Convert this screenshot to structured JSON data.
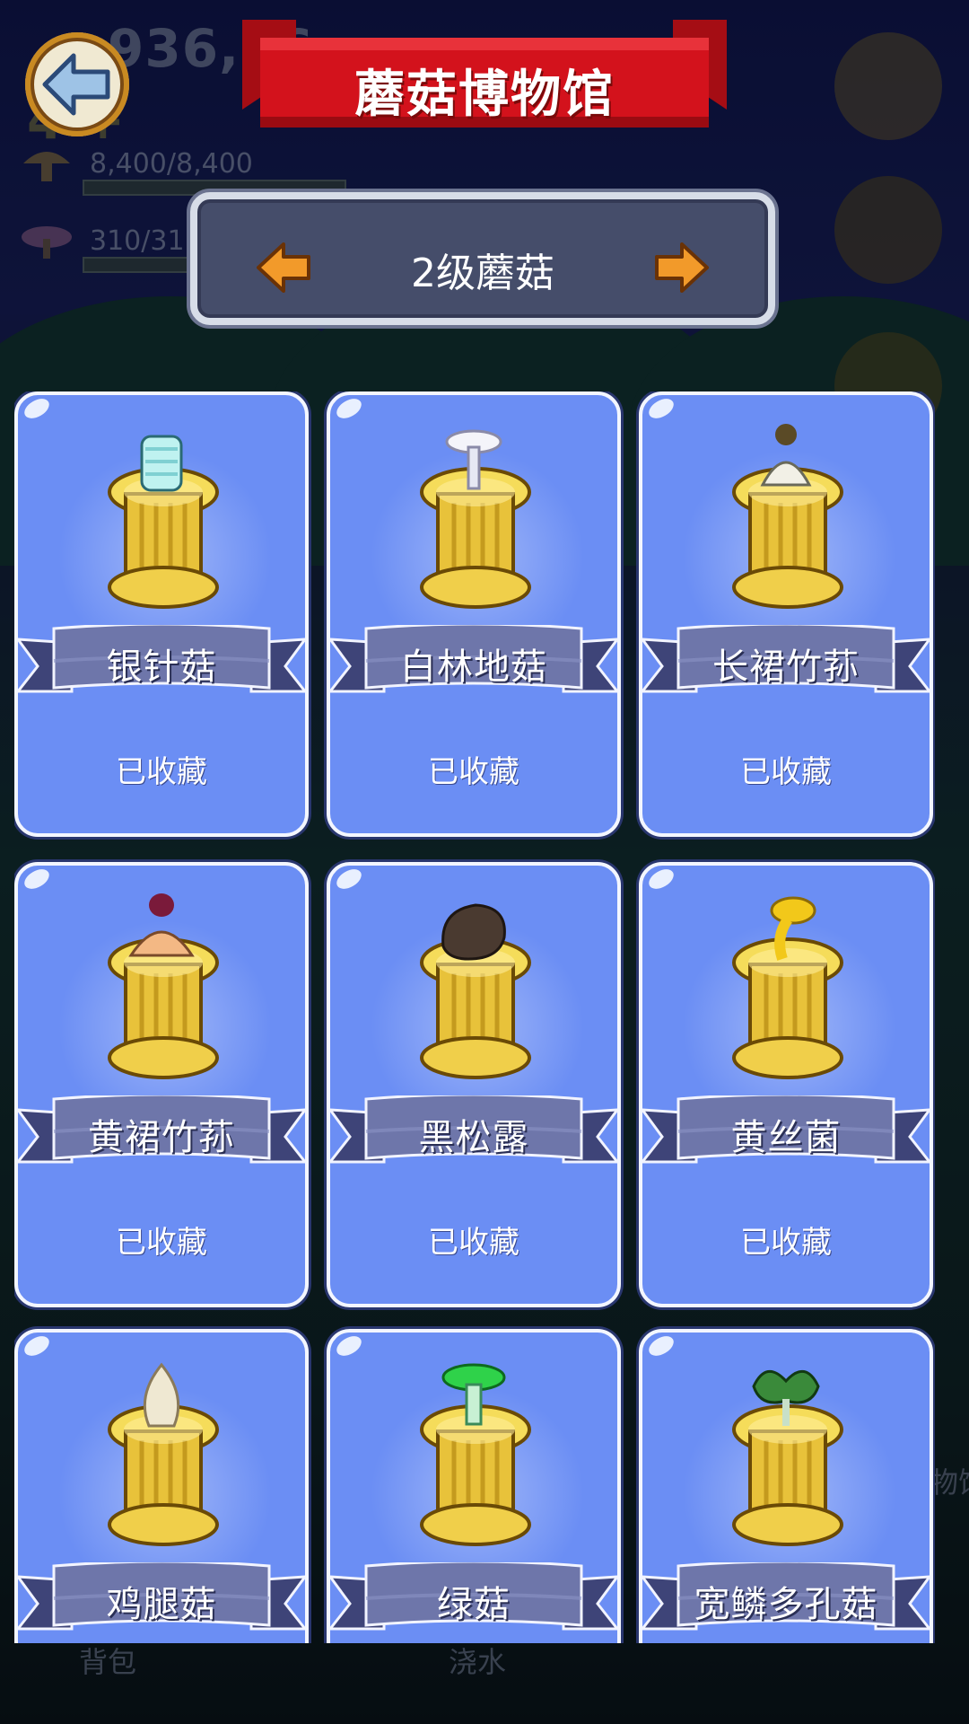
{
  "header": {
    "title": "蘑菇博物馆"
  },
  "background": {
    "coins": "936,56",
    "coin_sub": "4 +",
    "stat1": "8,400/8,400",
    "stat2": "310/31",
    "bottom_left_label": "背包",
    "bottom_center_label": "浇水",
    "right_edge_label": "物馆"
  },
  "selector": {
    "label": "2级蘑菇"
  },
  "cards": [
    {
      "name": "银针菇",
      "status": "已收藏",
      "icon": "silver-needle-mushroom-icon"
    },
    {
      "name": "白林地菇",
      "status": "已收藏",
      "icon": "white-woodland-mushroom-icon"
    },
    {
      "name": "长裙竹荪",
      "status": "已收藏",
      "icon": "long-skirt-bamboo-fungus-icon"
    },
    {
      "name": "黄裙竹荪",
      "status": "已收藏",
      "icon": "yellow-skirt-bamboo-fungus-icon"
    },
    {
      "name": "黑松露",
      "status": "已收藏",
      "icon": "black-truffle-icon"
    },
    {
      "name": "黄丝菌",
      "status": "已收藏",
      "icon": "yellow-fungus-icon"
    },
    {
      "name": "鸡腿菇",
      "status": "",
      "icon": "chicken-leg-mushroom-icon"
    },
    {
      "name": "绿菇",
      "status": "",
      "icon": "green-mushroom-icon"
    },
    {
      "name": "宽鳞多孔菇",
      "status": "",
      "icon": "wide-scale-polypore-icon"
    }
  ],
  "colors": {
    "card_bg": "#6b8ef4",
    "banner_red": "#d3121c",
    "selector_bg": "#454d6a",
    "pedestal_gold": "#f0cf4a"
  }
}
